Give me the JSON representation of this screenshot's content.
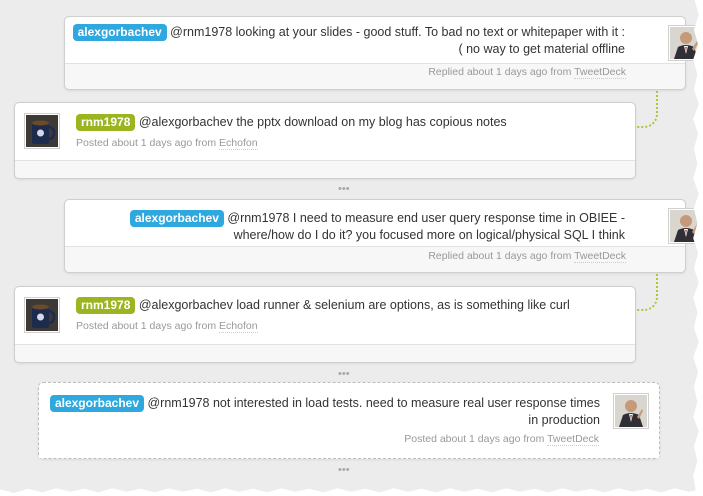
{
  "colors": {
    "user_tag_blue": "#2ea8df",
    "user_tag_green": "#9bb520",
    "connector": "#a9c73a",
    "meta_text": "#999999"
  },
  "thread": [
    {
      "user": "alexgorbachev",
      "text": "@rnm1978 looking at your slides - good stuff. To bad no text or whitepaper with it :( no way to get material offline",
      "meta_prefix": "Replied about 1 days ago from",
      "source": "TweetDeck",
      "avatar": "person-in-suit-photo"
    },
    {
      "user": "rnm1978",
      "text": "@alexgorbachev the pptx download on my blog has copious notes",
      "meta_prefix": "Posted about 1 days ago from",
      "source": "Echofon",
      "avatar": "coffee-mug-photo"
    },
    {
      "user": "alexgorbachev",
      "text": "@rnm1978 I need to measure end user query response time in OBIEE - where/how do I do it? you focused more on logical/physical SQL I think",
      "meta_prefix": "Replied about 1 days ago from",
      "source": "TweetDeck",
      "avatar": "person-in-suit-photo"
    },
    {
      "user": "rnm1978",
      "text": "@alexgorbachev load runner & selenium are options, as is something like curl",
      "meta_prefix": "Posted about 1 days ago from",
      "source": "Echofon",
      "avatar": "coffee-mug-photo"
    },
    {
      "user": "alexgorbachev",
      "text": "@rnm1978 not interested in load tests. need to measure real user response times in production",
      "meta_prefix": "Posted about 1 days ago from",
      "source": "TweetDeck",
      "avatar": "person-in-suit-photo"
    }
  ],
  "more_indicator": "•••"
}
